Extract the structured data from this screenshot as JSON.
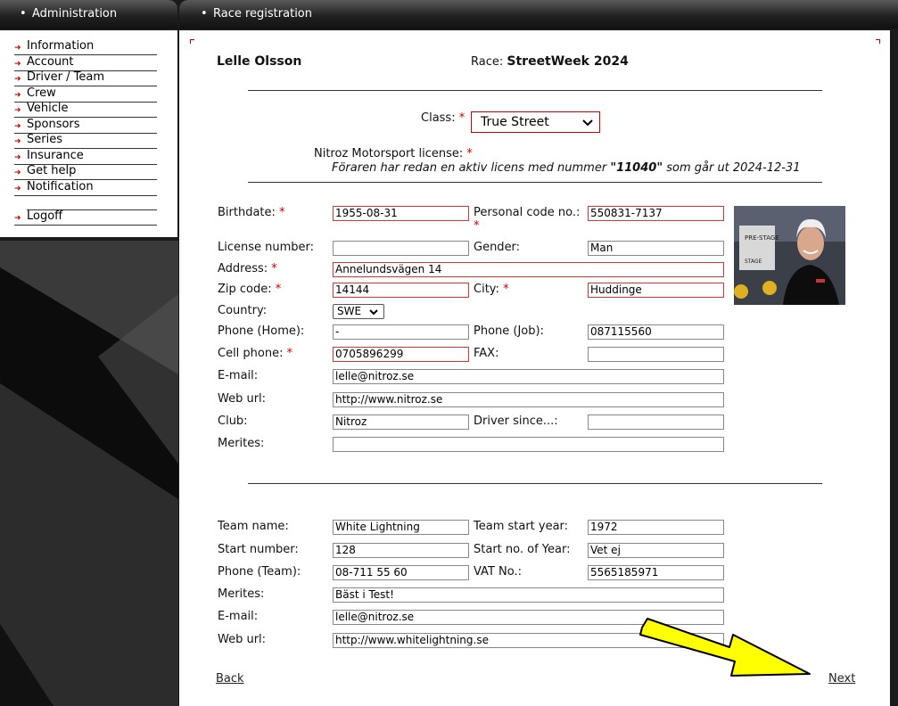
{
  "sidebar": {
    "title": "Administration",
    "items": [
      {
        "label": "Information"
      },
      {
        "label": "Account"
      },
      {
        "label": "Driver / Team"
      },
      {
        "label": "Crew"
      },
      {
        "label": "Vehicle"
      },
      {
        "label": "Sponsors"
      },
      {
        "label": "Series"
      },
      {
        "label": "Insurance"
      },
      {
        "label": "Get help"
      },
      {
        "label": "Notification"
      },
      {
        "label": "Logoff"
      }
    ]
  },
  "main": {
    "title": "Race registration",
    "driver_name": "Lelle Olsson",
    "race_label": "Race:",
    "race_name": "StreetWeek 2024",
    "class_label": "Class:",
    "class_value": "True Street",
    "license_label": "Nitroz Motorsport license:",
    "license_note_pre": "Föraren har redan en aktiv licens med nummer ",
    "license_number": "\"11040\"",
    "license_note_post": " som går ut 2024-12-31",
    "required_mark": "*"
  },
  "driver": {
    "birthdate_label": "Birthdate:",
    "birthdate": "1955-08-31",
    "personal_code_label": "Personal code no.:",
    "personal_code": "550831-7137",
    "license_number_label": "License number:",
    "license_number": "",
    "gender_label": "Gender:",
    "gender": "Man",
    "address_label": "Address:",
    "address": "Annelundsvägen 14",
    "zip_label": "Zip code:",
    "zip": "14144",
    "city_label": "City:",
    "city": "Huddinge",
    "country_label": "Country:",
    "country": "SWE",
    "phone_home_label": "Phone (Home):",
    "phone_home": "-",
    "phone_job_label": "Phone (Job):",
    "phone_job": "087115560",
    "cell_label": "Cell phone:",
    "cell": "0705896299",
    "fax_label": "FAX:",
    "fax": "",
    "email_label": "E-mail:",
    "email": "lelle@nitroz.se",
    "web_label": "Web url:",
    "web": "http://www.nitroz.se",
    "club_label": "Club:",
    "club": "Nitroz",
    "driver_since_label": "Driver since...:",
    "driver_since": "",
    "merites_label": "Merites:",
    "merites": ""
  },
  "team": {
    "name_label": "Team name:",
    "name": "White Lightning",
    "start_year_label": "Team start year:",
    "start_year": "1972",
    "start_number_label": "Start number:",
    "start_number": "128",
    "start_no_year_label": "Start no. of Year:",
    "start_no_year": "Vet ej",
    "phone_label": "Phone (Team):",
    "phone": "08-711 55 60",
    "vat_label": "VAT No.:",
    "vat": "5565185971",
    "merites_label": "Merites:",
    "merites": "Bäst i Test!",
    "email_label": "E-mail:",
    "email": "lelle@nitroz.se",
    "web_label": "Web url:",
    "web": "http://www.whitelightning.se"
  },
  "nav": {
    "back": "Back",
    "next": "Next"
  },
  "photo_texts": {
    "pre_stage": "PRE-STAGE",
    "stage": "STAGE"
  },
  "colors": {
    "required": "#cc0000",
    "annotation_arrow": "#ffff00"
  }
}
